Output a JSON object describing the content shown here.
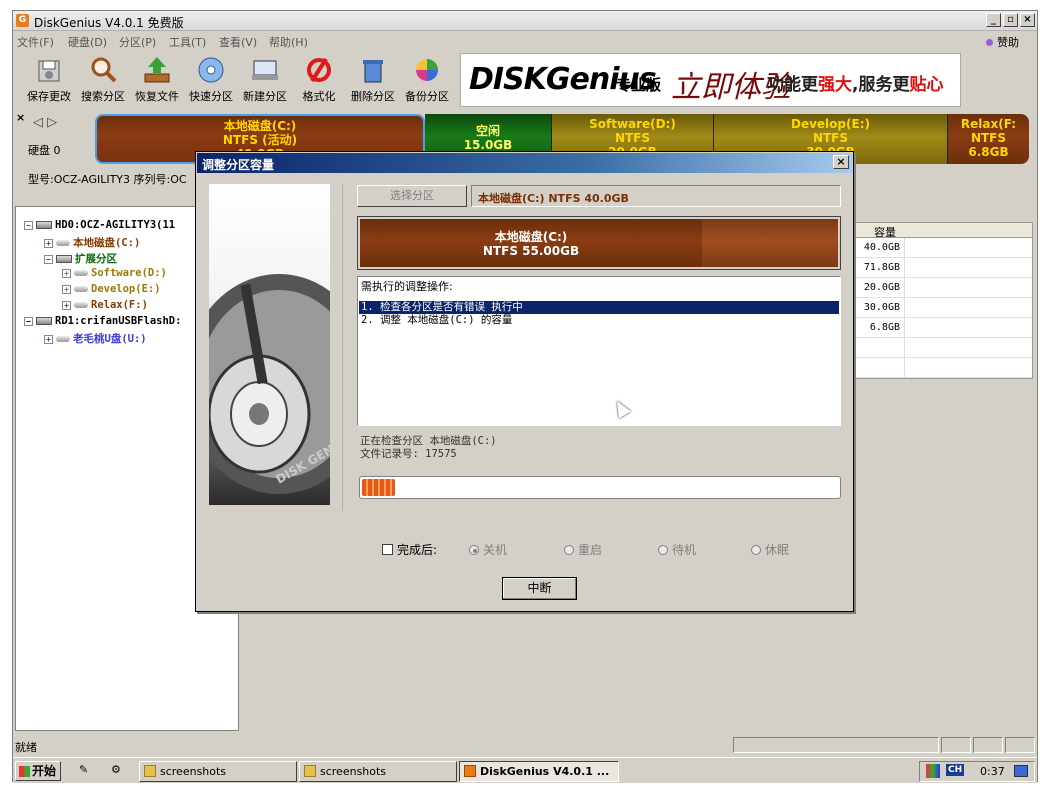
{
  "window": {
    "title": "DiskGenius V4.0.1 免费版"
  },
  "menu": [
    "文件(F)",
    "硬盘(D)",
    "分区(P)",
    "工具(T)",
    "查看(V)",
    "帮助(H)"
  ],
  "sponsor": "赞助",
  "toolbar": {
    "save": "保存更改",
    "search": "搜索分区",
    "recover": "恢复文件",
    "quick": "快速分区",
    "new": "新建分区",
    "format": "格式化",
    "delete": "删除分区",
    "backup": "备份分区"
  },
  "banner": {
    "brand": "DISKGenius",
    "edition": "专业版",
    "slogan_a": "立即体验",
    "slogan_b1": "功能更",
    "slogan_b2": "强大",
    "slogan_b3": ",服务更",
    "slogan_b4": "贴心"
  },
  "diskmap": {
    "disk_label": "硬盘 0",
    "model_line": "型号:OCZ-AGILITY3  序列号:OC",
    "partitions": [
      {
        "name": "本地磁盘(C:)",
        "fs": "NTFS (活动)",
        "size": "40.0GB"
      },
      {
        "name": "空闲",
        "size": "15.0GB"
      },
      {
        "name": "Software(D:)",
        "fs": "NTFS",
        "size": "20.0GB"
      },
      {
        "name": "Develop(E:)",
        "fs": "NTFS",
        "size": "30.0GB"
      },
      {
        "name": "Relax(F:",
        "fs": "NTFS",
        "size": "6.8GB"
      }
    ]
  },
  "tree": {
    "hd0": "HD0:OCZ-AGILITY3(11",
    "c": "本地磁盘(C:)",
    "ext": "扩展分区",
    "d": "Software(D:)",
    "e": "Develop(E:)",
    "f": "Relax(F:)",
    "rd1": "RD1:crifanUSBFlashD:",
    "u": "老毛桃U盘(U:)"
  },
  "grid": {
    "header": "容量",
    "rows": [
      "40.0GB",
      "71.8GB",
      "20.0GB",
      "30.0GB",
      "6.8GB"
    ]
  },
  "dialog": {
    "title": "调整分区容量",
    "select_btn": "选择分区",
    "select_info": "本地磁盘(C:) NTFS 40.0GB",
    "preview_name": "本地磁盘(C:)",
    "preview_info": "NTFS 55.00GB",
    "ops_header": "需执行的调整操作:",
    "ops": [
      "1. 检查各分区是否有错误    执行中",
      "2. 调整 本地磁盘(C:) 的容量"
    ],
    "status_line1": "正在检查分区 本地磁盘(C:)",
    "status_line2": "文件记录号: 17575",
    "progress": 0.07,
    "after_label": "完成后:",
    "after_options": [
      "关机",
      "重启",
      "待机",
      "休眠"
    ],
    "abort": "中断"
  },
  "status": "就绪",
  "taskbar": {
    "start": "开始",
    "items": [
      "screenshots",
      "screenshots",
      "DiskGenius V4.0.1 ..."
    ],
    "ime": "CH",
    "time": "0:37"
  }
}
